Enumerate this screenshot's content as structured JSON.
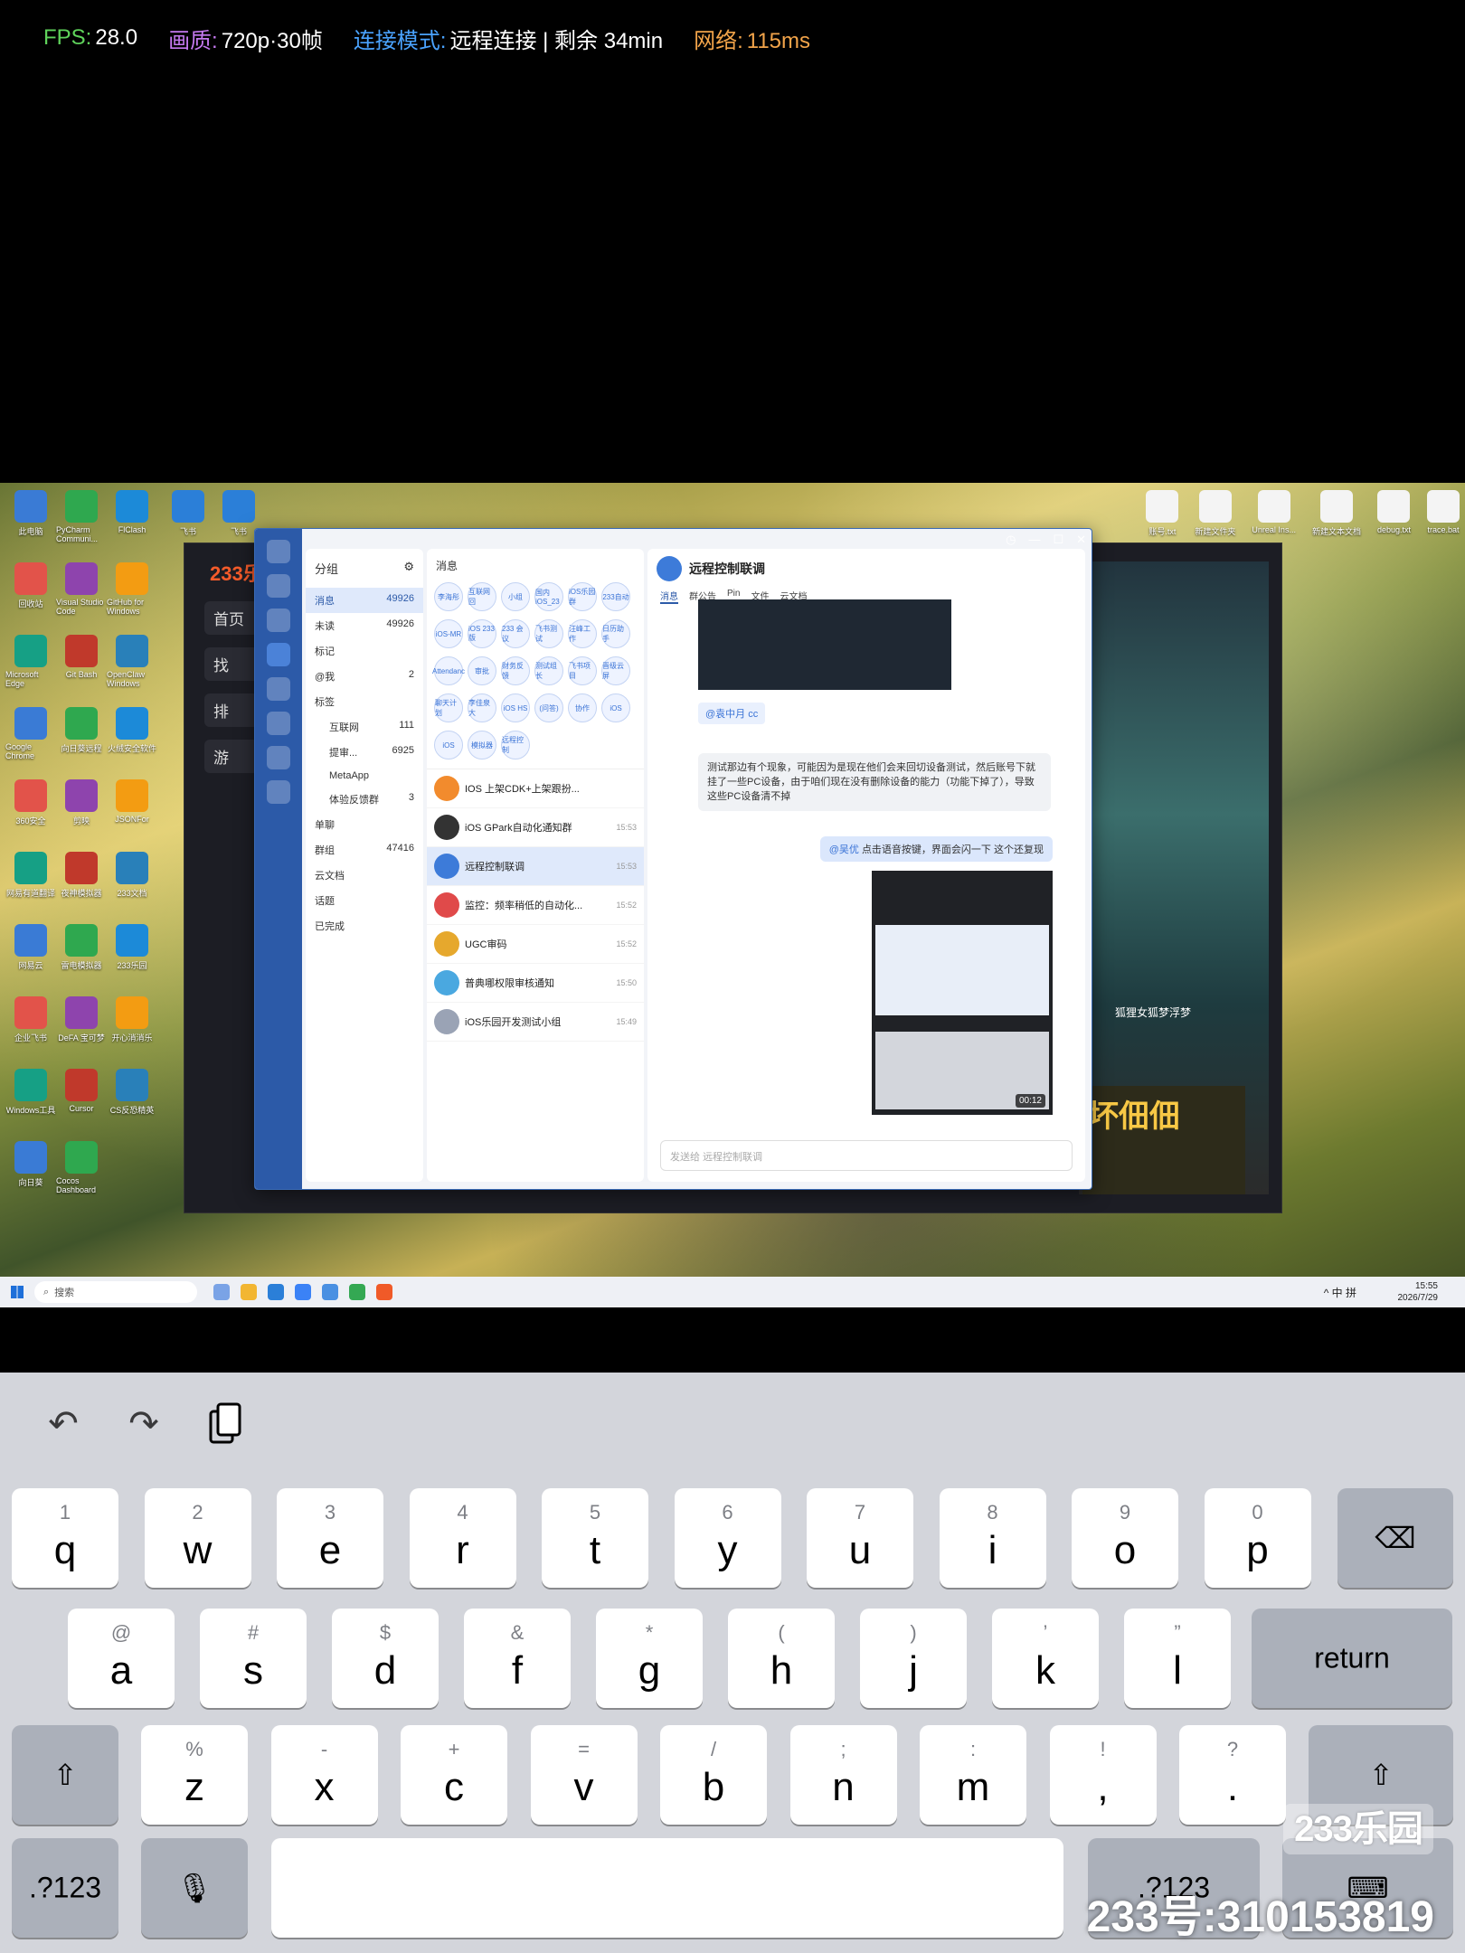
{
  "stats": {
    "fps_label": "FPS:",
    "fps_value": "28.0",
    "quality_label": "画质:",
    "quality_value": "720p·30帧",
    "conn_label": "连接模式:",
    "conn_value": "远程连接 | 剩余 34min",
    "net_label": "网络:",
    "net_value": "115ms"
  },
  "desktop": {
    "icons": [
      "此电脑",
      "PyCharm Communi...",
      "FlClash",
      "回收站",
      "Visual Studio Code",
      "GitHub for Windows",
      "Microsoft Edge",
      "Git Bash",
      "OpenClaw Windows",
      "Google Chrome",
      "向日葵远程",
      "火绒安全软件",
      "360安全",
      "剪映",
      "JSONFor",
      "网易有道翻译",
      "夜神模拟器",
      "233文档",
      "网易云",
      "雷电模拟器",
      "233乐园",
      "企业飞书",
      "DeFA 宝可梦",
      "开心消消乐",
      "Windows工具",
      "Cursor",
      "CS反恐精英",
      "向日葵",
      "Cocos Dashboard"
    ],
    "top_icons": [
      "飞书",
      "飞书"
    ],
    "right_icons": [
      "账号.txt",
      "新建文件夹",
      "Unreal Ins...",
      "新建文本文档",
      "debug.txt",
      "trace.bat"
    ]
  },
  "bgapp": {
    "brand": "233乐园",
    "nav": [
      "首页",
      "找",
      "排",
      "游"
    ],
    "art_caption": "狐狸女狐梦浮梦",
    "banner": "坏佃佃"
  },
  "feishu": {
    "group_title": "分组",
    "groups": [
      {
        "label": "消息",
        "count": "49926"
      },
      {
        "label": "未读",
        "count": "49926"
      },
      {
        "label": "标记",
        "count": ""
      },
      {
        "label": "@我",
        "count": "2"
      },
      {
        "label": "标签",
        "count": ""
      },
      {
        "label": "互联网",
        "count": "111"
      },
      {
        "label": "提审...",
        "count": "6925"
      },
      {
        "label": "MetaApp",
        "count": ""
      },
      {
        "label": "体验反馈群",
        "count": "3"
      },
      {
        "label": "单聊",
        "count": ""
      },
      {
        "label": "群组",
        "count": "47416"
      },
      {
        "label": "云文档",
        "count": ""
      },
      {
        "label": "话题",
        "count": ""
      },
      {
        "label": "已完成",
        "count": ""
      }
    ],
    "list_title": "消息",
    "avatars": [
      "李海彤",
      "互联网回",
      "小组",
      "国内iOS_23",
      "iOS乐园群",
      "233自动",
      "iOS-MR",
      "iOS 233版",
      "233 会议",
      "飞书测试",
      "汪峰工作",
      "日历助手",
      "Attendanc",
      "审批",
      "财务反馈",
      "测试组长",
      "飞书项目",
      "晋级云屏",
      "聊天计划",
      "李佳泉大",
      "iOS HS",
      "(问答)",
      "协作",
      "iOS",
      "iOS",
      "模拟器",
      "远程控制"
    ],
    "conversations": [
      {
        "title": "IOS 上架CDK+上架跟扮...",
        "time": ""
      },
      {
        "title": "iOS GPark自动化通知群",
        "time": "15:53"
      },
      {
        "title": "远程控制联调",
        "time": "15:53"
      },
      {
        "title": "监控：频率稍低的自动化...",
        "time": "15:52"
      },
      {
        "title": "UGC审码",
        "time": "15:52"
      },
      {
        "title": "普典哪权限审核通知",
        "time": "15:50"
      },
      {
        "title": "iOS乐园开发测试小组",
        "time": "15:49"
      }
    ],
    "chat": {
      "title": "远程控制联调",
      "tabs": [
        "消息",
        "群公告",
        "Pin",
        "文件",
        "云文档"
      ],
      "mention": "@袁中月 cc",
      "message": "测试那边有个现象，可能因为是现在他们会来回切设备测试，然后账号下就挂了一些PC设备，由于咱们现在没有删除设备的能力（功能下掉了），导致这些PC设备清不掉",
      "mine_name": "@吴优",
      "mine_text": "点击语音按键，界面会闪一下 这个还复现",
      "video_duration": "00:12",
      "input_placeholder": "发送给 远程控制联调"
    }
  },
  "taskbar": {
    "search": "搜索",
    "tray": "^ 中 拼",
    "time": "15:55",
    "date": "2026/7/29"
  },
  "keyboard": {
    "toolbar": [
      "undo-icon",
      "redo-icon",
      "clipboard-icon"
    ],
    "row1": [
      {
        "hint": "1",
        "main": "q"
      },
      {
        "hint": "2",
        "main": "w"
      },
      {
        "hint": "3",
        "main": "e"
      },
      {
        "hint": "4",
        "main": "r"
      },
      {
        "hint": "5",
        "main": "t"
      },
      {
        "hint": "6",
        "main": "y"
      },
      {
        "hint": "7",
        "main": "u"
      },
      {
        "hint": "8",
        "main": "i"
      },
      {
        "hint": "9",
        "main": "o"
      },
      {
        "hint": "0",
        "main": "p"
      }
    ],
    "row2": [
      {
        "hint": "@",
        "main": "a"
      },
      {
        "hint": "#",
        "main": "s"
      },
      {
        "hint": "$",
        "main": "d"
      },
      {
        "hint": "&",
        "main": "f"
      },
      {
        "hint": "*",
        "main": "g"
      },
      {
        "hint": "(",
        "main": "h"
      },
      {
        "hint": ")",
        "main": "j"
      },
      {
        "hint": "’",
        "main": "k"
      },
      {
        "hint": "”",
        "main": "l"
      }
    ],
    "row3": [
      {
        "hint": "%",
        "main": "z"
      },
      {
        "hint": "-",
        "main": "x"
      },
      {
        "hint": "+",
        "main": "c"
      },
      {
        "hint": "=",
        "main": "v"
      },
      {
        "hint": "/",
        "main": "b"
      },
      {
        "hint": ";",
        "main": "n"
      },
      {
        "hint": ":",
        "main": "m"
      },
      {
        "hint": "!",
        "main": ","
      },
      {
        "hint": "?",
        "main": "."
      }
    ],
    "return": "return",
    "numbers": ".?123",
    "numbers_right": ".?123",
    "delete": "⌫",
    "shift": "⇧",
    "mic": "🎙",
    "hide": "⌨"
  },
  "watermark": {
    "logo": "233乐园",
    "id": "233号:310153819"
  }
}
